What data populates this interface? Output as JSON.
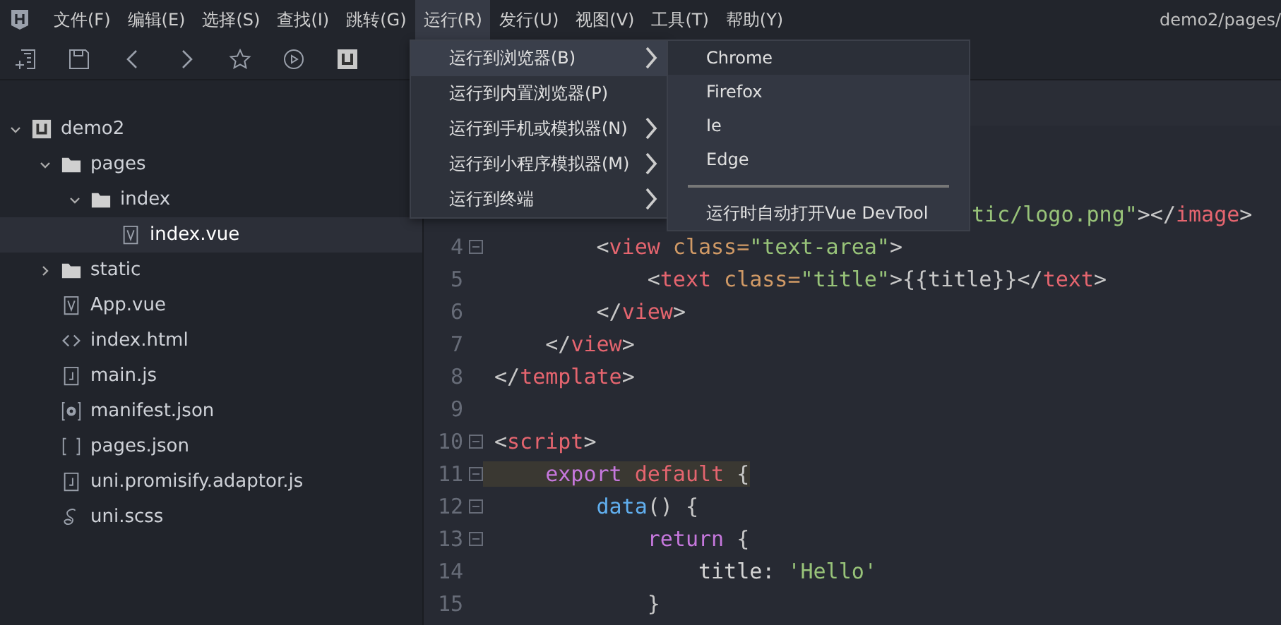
{
  "menubar": {
    "items": [
      {
        "label": "文件(F)",
        "selected": false
      },
      {
        "label": "编辑(E)",
        "selected": false
      },
      {
        "label": "选择(S)",
        "selected": false
      },
      {
        "label": "查找(I)",
        "selected": false
      },
      {
        "label": "跳转(G)",
        "selected": false
      },
      {
        "label": "运行(R)",
        "selected": true
      },
      {
        "label": "发行(U)",
        "selected": false
      },
      {
        "label": "视图(V)",
        "selected": false
      },
      {
        "label": "工具(T)",
        "selected": false
      },
      {
        "label": "帮助(Y)",
        "selected": false
      }
    ],
    "title": "demo2/pages/"
  },
  "run_menu": {
    "items": [
      {
        "label": "运行到浏览器(B)",
        "submenu": true,
        "selected": true
      },
      {
        "label": "运行到内置浏览器(P)",
        "submenu": false,
        "selected": false
      },
      {
        "label": "运行到手机或模拟器(N)",
        "submenu": true,
        "selected": false
      },
      {
        "label": "运行到小程序模拟器(M)",
        "submenu": true,
        "selected": false
      },
      {
        "label": "运行到终端",
        "submenu": true,
        "selected": false
      }
    ]
  },
  "browser_submenu": {
    "items": [
      {
        "kind": "item",
        "label": "Chrome",
        "selected": true
      },
      {
        "kind": "item",
        "label": "Firefox",
        "selected": false
      },
      {
        "kind": "item",
        "label": "Ie",
        "selected": false
      },
      {
        "kind": "item",
        "label": "Edge",
        "selected": false
      },
      {
        "kind": "separator"
      },
      {
        "kind": "item",
        "label": "运行时自动打开Vue DevTool",
        "selected": false
      }
    ]
  },
  "sidebar": {
    "tree": [
      {
        "label": "demo2",
        "kind": "project",
        "expanded": true,
        "selected": false,
        "children": [
          {
            "label": "pages",
            "kind": "folder",
            "expanded": true,
            "selected": false,
            "children": [
              {
                "label": "index",
                "kind": "folder",
                "expanded": true,
                "selected": false,
                "children": [
                  {
                    "label": "index.vue",
                    "kind": "vue",
                    "selected": true
                  }
                ]
              }
            ]
          },
          {
            "label": "static",
            "kind": "folder",
            "expanded": false,
            "selected": false
          },
          {
            "label": "App.vue",
            "kind": "vue",
            "selected": false
          },
          {
            "label": "index.html",
            "kind": "html",
            "selected": false
          },
          {
            "label": "main.js",
            "kind": "js",
            "selected": false
          },
          {
            "label": "manifest.json",
            "kind": "settings",
            "selected": false
          },
          {
            "label": "pages.json",
            "kind": "json",
            "selected": false
          },
          {
            "label": "uni.promisify.adaptor.js",
            "kind": "js",
            "selected": false
          },
          {
            "label": "uni.scss",
            "kind": "scss",
            "selected": false
          }
        ]
      }
    ]
  },
  "editor": {
    "lines": [
      {
        "covered": true,
        "tokens": [
          {
            "text": "tic/logo.png\"",
            "kind": "string"
          },
          {
            "text": "></",
            "kind": "punct"
          },
          {
            "text": "image",
            "kind": "tag"
          },
          {
            "text": ">",
            "kind": "punct"
          }
        ]
      },
      {
        "number": "4",
        "fold": true,
        "tokens": [
          {
            "text": "        <",
            "kind": "punct"
          },
          {
            "text": "view",
            "kind": "tag"
          },
          {
            "text": " class=",
            "kind": "attr"
          },
          {
            "text": "\"text-area\"",
            "kind": "string"
          },
          {
            "text": ">",
            "kind": "punct"
          }
        ]
      },
      {
        "number": "5",
        "tokens": [
          {
            "text": "            <",
            "kind": "punct"
          },
          {
            "text": "text",
            "kind": "tag"
          },
          {
            "text": " class=",
            "kind": "attr"
          },
          {
            "text": "\"title\"",
            "kind": "string"
          },
          {
            "text": ">{{title}}</",
            "kind": "punct"
          },
          {
            "text": "text",
            "kind": "tag"
          },
          {
            "text": ">",
            "kind": "punct"
          }
        ]
      },
      {
        "number": "6",
        "tokens": [
          {
            "text": "        </",
            "kind": "punct"
          },
          {
            "text": "view",
            "kind": "tag"
          },
          {
            "text": ">",
            "kind": "punct"
          }
        ]
      },
      {
        "number": "7",
        "tokens": [
          {
            "text": "    </",
            "kind": "punct"
          },
          {
            "text": "view",
            "kind": "tag"
          },
          {
            "text": ">",
            "kind": "punct"
          }
        ]
      },
      {
        "number": "8",
        "tokens": [
          {
            "text": "</",
            "kind": "punct"
          },
          {
            "text": "template",
            "kind": "tag"
          },
          {
            "text": ">",
            "kind": "punct"
          }
        ]
      },
      {
        "number": "9"
      },
      {
        "number": "10",
        "fold": true,
        "tokens": [
          {
            "text": "<",
            "kind": "punct"
          },
          {
            "text": "script",
            "kind": "tag"
          },
          {
            "text": ">",
            "kind": "punct"
          }
        ]
      },
      {
        "number": "11",
        "fold": true,
        "current": true,
        "tokens": [
          {
            "text": "    export",
            "kind": "keyword"
          },
          {
            "text": " default",
            "kind": "tag"
          },
          {
            "text": " {",
            "kind": "punct"
          }
        ]
      },
      {
        "number": "12",
        "fold": true,
        "tokens": [
          {
            "text": "        data",
            "kind": "func"
          },
          {
            "text": "() {",
            "kind": "punct"
          }
        ]
      },
      {
        "number": "13",
        "fold": true,
        "tokens": [
          {
            "text": "            return",
            "kind": "keyword"
          },
          {
            "text": " {",
            "kind": "punct"
          }
        ]
      },
      {
        "number": "14",
        "tokens": [
          {
            "text": "                title: ",
            "kind": "plain"
          },
          {
            "text": "'Hello'",
            "kind": "string"
          }
        ]
      },
      {
        "number": "15",
        "tokens": [
          {
            "text": "            }",
            "kind": "punct"
          }
        ]
      }
    ]
  }
}
